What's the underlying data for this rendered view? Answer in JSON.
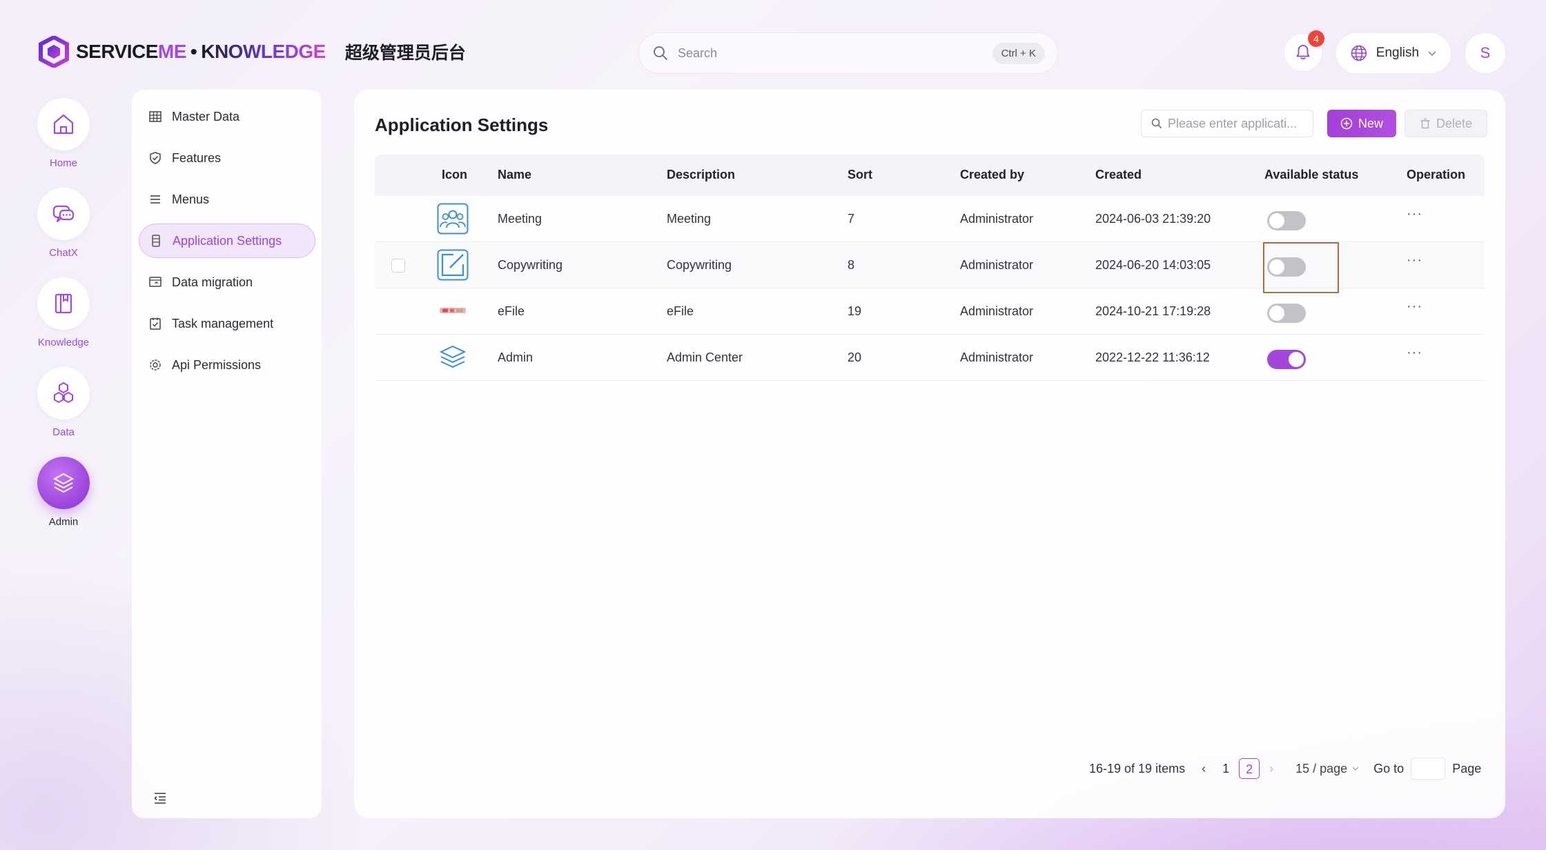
{
  "header": {
    "brand_service": "SERVICE",
    "brand_me": "ME",
    "brand_knowledge": "KNOWLEDGE",
    "brand_sub": "超级管理员后台",
    "search_placeholder": "Search",
    "search_shortcut": "Ctrl + K",
    "notifications_count": "4",
    "language": "English",
    "avatar_initial": "S"
  },
  "rail": [
    {
      "label": "Home",
      "icon": "home-icon"
    },
    {
      "label": "ChatX",
      "icon": "chat-icon"
    },
    {
      "label": "Knowledge",
      "icon": "book-icon"
    },
    {
      "label": "Data",
      "icon": "hexagons-icon"
    },
    {
      "label": "Admin",
      "icon": "layers-icon",
      "active": true
    }
  ],
  "sidemenu": [
    {
      "label": "Master Data",
      "icon": "table-icon"
    },
    {
      "label": "Features",
      "icon": "shield-check-icon"
    },
    {
      "label": "Menus",
      "icon": "list-icon"
    },
    {
      "label": "Application Settings",
      "icon": "server-icon",
      "active": true
    },
    {
      "label": "Data migration",
      "icon": "migrate-icon"
    },
    {
      "label": "Task management",
      "icon": "task-icon"
    },
    {
      "label": "Api Permissions",
      "icon": "gear-icon"
    }
  ],
  "main": {
    "title": "Application Settings",
    "filter_placeholder": "Please enter applicati...",
    "new_label": "New",
    "delete_label": "Delete",
    "columns": [
      "Icon",
      "Name",
      "Description",
      "Sort",
      "Created by",
      "Created",
      "Available status",
      "Operation"
    ],
    "rows": [
      {
        "icon": "meeting-icon",
        "name": "Meeting",
        "description": "Meeting",
        "sort": "7",
        "created_by": "Administrator",
        "created": "2024-06-03 21:39:20",
        "enabled": false,
        "op": "···"
      },
      {
        "icon": "edit-icon",
        "name": "Copywriting",
        "description": "Copywriting",
        "sort": "8",
        "created_by": "Administrator",
        "created": "2024-06-20 14:03:05",
        "enabled": false,
        "op": "···"
      },
      {
        "icon": "efile-logo-icon",
        "name": "eFile",
        "description": "eFile",
        "sort": "19",
        "created_by": "Administrator",
        "created": "2024-10-21 17:19:28",
        "enabled": false,
        "op": "···"
      },
      {
        "icon": "layers-icon",
        "name": "Admin",
        "description": "Admin Center",
        "sort": "20",
        "created_by": "Administrator",
        "created": "2022-12-22 11:36:12",
        "enabled": true,
        "op": "···"
      }
    ],
    "pagination": {
      "summary": "16-19 of 19 items",
      "pages": [
        "1",
        "2"
      ],
      "current_page": "2",
      "page_size": "15 / page",
      "goto_label": "Go to",
      "page_label": "Page"
    }
  }
}
